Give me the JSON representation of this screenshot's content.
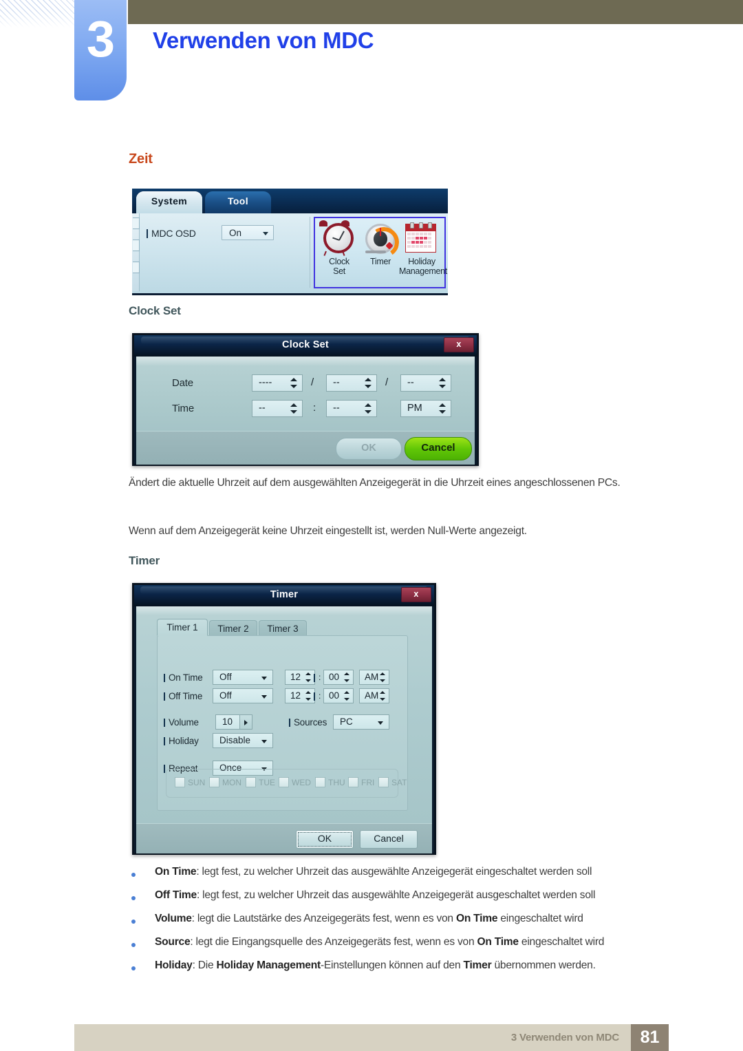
{
  "header": {
    "chapter_number": "3",
    "chapter_title": "Verwenden von MDC"
  },
  "section": {
    "title": "Zeit"
  },
  "system_panel": {
    "tabs": [
      {
        "label": "System",
        "active": true
      },
      {
        "label": "Tool",
        "active": false
      }
    ],
    "osd_label": "MDC OSD",
    "osd_value": "On",
    "icons": [
      {
        "name": "clock-set-icon",
        "caption_line1": "Clock",
        "caption_line2": "Set"
      },
      {
        "name": "timer-icon",
        "caption_line1": "Timer",
        "caption_line2": ""
      },
      {
        "name": "holiday-management-icon",
        "caption_line1": "Holiday",
        "caption_line2": "Management"
      }
    ],
    "highlight_color": "#4032e0"
  },
  "clock_set_heading": "Clock Set",
  "clock_set_dialog": {
    "title": "Clock Set",
    "close_label": "x",
    "date_label": "Date",
    "time_label": "Time",
    "date_year": "----",
    "date_month": "--",
    "date_day": "--",
    "date_sep1": "/",
    "date_sep2": "/",
    "time_hour": "--",
    "time_minute": "--",
    "time_meridiem": "PM",
    "time_sep": ":",
    "ok_label": "OK",
    "cancel_label": "Cancel",
    "cancel_color": "#62c707"
  },
  "paragraphs": {
    "p1": "Ändert die aktuelle Uhrzeit auf dem ausgewählten Anzeigegerät in die Uhrzeit eines angeschlossenen PCs.",
    "p2": "Wenn auf dem Anzeigegerät keine Uhrzeit eingestellt ist, werden Null-Werte angezeigt."
  },
  "timer_heading": "Timer",
  "timer_dialog": {
    "title": "Timer",
    "close_label": "x",
    "tabs": [
      {
        "label": "Timer 1",
        "active": true
      },
      {
        "label": "Timer 2",
        "active": false
      },
      {
        "label": "Timer 3",
        "active": false
      }
    ],
    "on_time_label": "On Time",
    "on_time_mode": "Off",
    "on_time_hour": "12",
    "on_time_minute": "00",
    "on_time_meridiem": "AM",
    "off_time_label": "Off Time",
    "off_time_mode": "Off",
    "off_time_hour": "12",
    "off_time_minute": "00",
    "off_time_meridiem": "AM",
    "time_sep": ":",
    "volume_label": "Volume",
    "volume_value": "10",
    "sources_label": "Sources",
    "sources_value": "PC",
    "holiday_label": "Holiday",
    "holiday_value": "Disable",
    "repeat_label": "Repeat",
    "repeat_value": "Once",
    "days": [
      "SUN",
      "MON",
      "TUE",
      "WED",
      "THU",
      "FRI",
      "SAT"
    ],
    "ok_label": "OK",
    "cancel_label": "Cancel"
  },
  "bullets": [
    {
      "term": "On Time",
      "rest_before": ": legt fest, zu welcher Uhrzeit das ausgewählte Anzeigegerät eingeschaltet werden soll",
      "term2": "",
      "rest_after": ""
    },
    {
      "term": "Off Time",
      "rest_before": ": legt fest, zu welcher Uhrzeit das ausgewählte Anzeigegerät ausgeschaltet werden soll",
      "term2": "",
      "rest_after": ""
    },
    {
      "term": "Volume",
      "rest_before": ": legt die Lautstärke des Anzeigegeräts fest, wenn es von ",
      "term2": "On Time",
      "rest_after": " eingeschaltet wird"
    },
    {
      "term": "Source",
      "rest_before": ": legt die Eingangsquelle des Anzeigegeräts fest, wenn es von ",
      "term2": "On Time",
      "rest_after": " eingeschaltet wird"
    },
    {
      "term": "Holiday",
      "rest_before": ": Die ",
      "term2": "Holiday Management",
      "rest_after": "-Einstellungen können auf den ",
      "term3": "Timer",
      "rest_end": " übernommen werden."
    }
  ],
  "footer": {
    "text": "3 Verwenden von MDC",
    "page": "81"
  }
}
